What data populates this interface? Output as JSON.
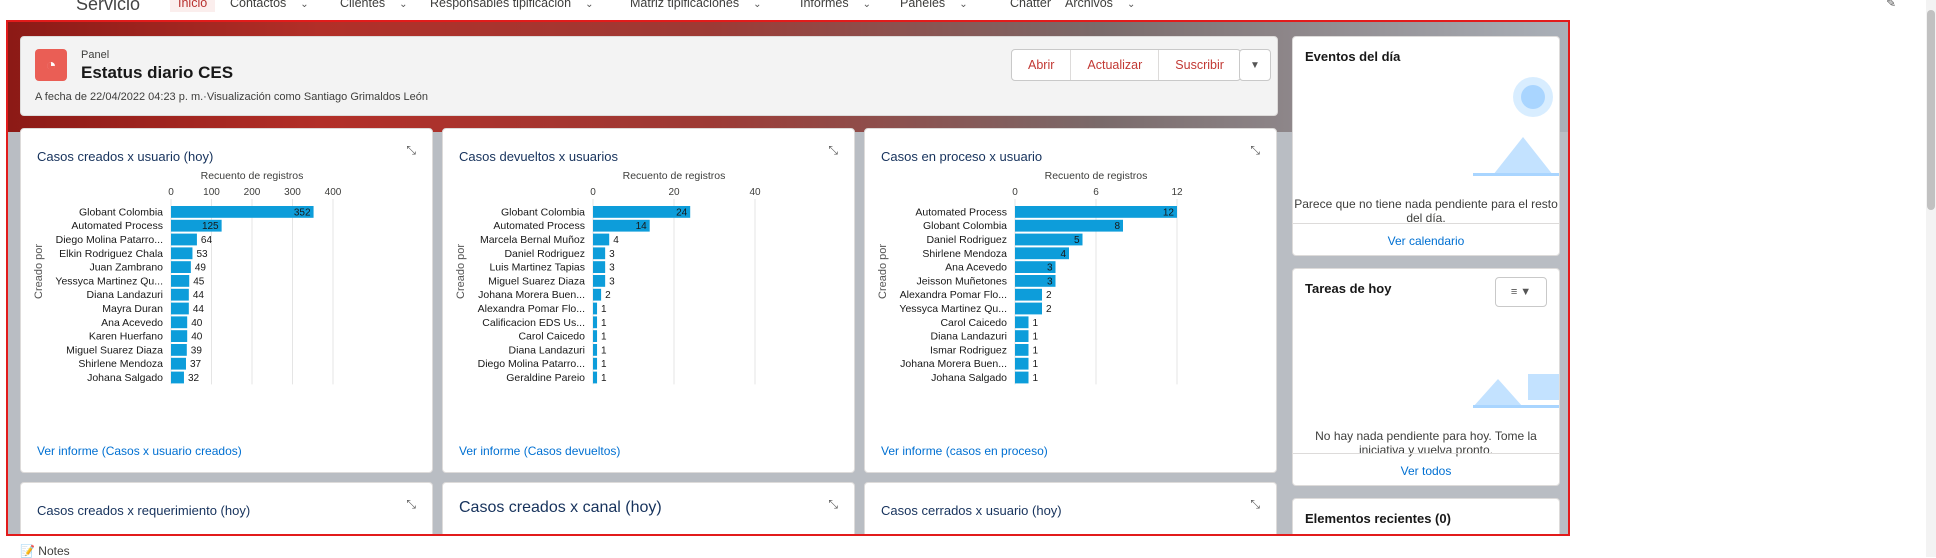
{
  "nav": {
    "app_name": "Servicio",
    "items": [
      {
        "label": "Inicio",
        "active": true
      },
      {
        "label": "Contactos",
        "dropdown": true
      },
      {
        "label": "Clientes",
        "dropdown": true
      },
      {
        "label": "Responsables tipificación",
        "dropdown": true
      },
      {
        "label": "Matriz tipificaciones",
        "dropdown": true
      },
      {
        "label": "Informes",
        "dropdown": true
      },
      {
        "label": "Paneles",
        "dropdown": true
      },
      {
        "label": "Chatter",
        "dropdown": false
      },
      {
        "label": "Archivos",
        "dropdown": true
      }
    ]
  },
  "header": {
    "type_label": "Panel",
    "title": "Estatus diario CES",
    "meta": "A fecha de 22/04/2022 04:23 p. m.·Visualización como Santiago Grimaldos León",
    "buttons": [
      "Abrir",
      "Actualizar",
      "Suscribir"
    ]
  },
  "colors": {
    "bar": "#0d9dda",
    "link": "#0070d2",
    "accent": "#c23934"
  },
  "chart_data": [
    {
      "type": "bar",
      "orientation": "horizontal",
      "title": "Casos creados x usuario (hoy)",
      "xlabel": "Recuento de registros",
      "ylabel": "Creado por",
      "xticks": [
        0,
        100,
        200,
        300,
        400
      ],
      "xlim": [
        0,
        400
      ],
      "categories": [
        "Globant Colombia",
        "Automated Process",
        "Diego Molina Patarro...",
        "Elkin Rodriguez Chala",
        "Juan Zambrano",
        "Yessyca Martinez Qu...",
        "Diana Landazuri",
        "Mayra Duran",
        "Ana Acevedo",
        "Karen Huerfano",
        "Miguel Suarez Diaza",
        "Shirlene Mendoza",
        "Johana Salgado"
      ],
      "values": [
        352,
        125,
        64,
        53,
        49,
        45,
        44,
        44,
        40,
        40,
        39,
        37,
        32
      ],
      "footer": "Ver informe (Casos x usuario creados)"
    },
    {
      "type": "bar",
      "orientation": "horizontal",
      "title": "Casos devueltos x usuarios",
      "xlabel": "Recuento de registros",
      "ylabel": "Creado por",
      "xticks": [
        0,
        20,
        40
      ],
      "xlim": [
        0,
        40
      ],
      "categories": [
        "Globant Colombia",
        "Automated Process",
        "Marcela Bernal Muñoz",
        "Daniel Rodriguez",
        "Luis Martinez Tapias",
        "Miguel Suarez Diaza",
        "Johana Morera Buen...",
        "Alexandra Pomar Flo...",
        "Calificacion EDS Us...",
        "Carol Caicedo",
        "Diana Landazuri",
        "Diego Molina Patarro...",
        "Geraldine Pareio"
      ],
      "values": [
        24,
        14,
        4,
        3,
        3,
        3,
        2,
        1,
        1,
        1,
        1,
        1,
        1
      ],
      "footer": "Ver informe (Casos devueltos)"
    },
    {
      "type": "bar",
      "orientation": "horizontal",
      "title": "Casos en proceso x usuario",
      "xlabel": "Recuento de registros",
      "ylabel": "Creado por",
      "xticks": [
        0,
        6,
        12
      ],
      "xlim": [
        0,
        12
      ],
      "categories": [
        "Automated Process",
        "Globant Colombia",
        "Daniel Rodriguez",
        "Shirlene Mendoza",
        "Ana Acevedo",
        "Jeisson Muñetones",
        "Alexandra Pomar Flo...",
        "Yessyca Martinez Qu...",
        "Carol Caicedo",
        "Diana Landazuri",
        "Ismar Rodriguez",
        "Johana Morera Buen...",
        "Johana Salgado"
      ],
      "values": [
        12,
        8,
        5,
        4,
        3,
        3,
        2,
        2,
        1,
        1,
        1,
        1,
        1
      ],
      "footer": "Ver informe (casos en proceso)"
    }
  ],
  "lower_cards": [
    "Casos creados x requerimiento (hoy)",
    "Casos creados x canal (hoy)",
    "Casos cerrados x usuario (hoy)"
  ],
  "side": {
    "events": {
      "title": "Eventos del día",
      "message": "Parece que no tiene nada pendiente para el resto del día.",
      "link": "Ver calendario"
    },
    "tasks": {
      "title": "Tareas de hoy",
      "message": "No hay nada pendiente para hoy. Tome la iniciativa y vuelva pronto.",
      "link": "Ver todos"
    },
    "recent": {
      "title": "Elementos recientes (0)"
    }
  },
  "notes_label": "Notes"
}
